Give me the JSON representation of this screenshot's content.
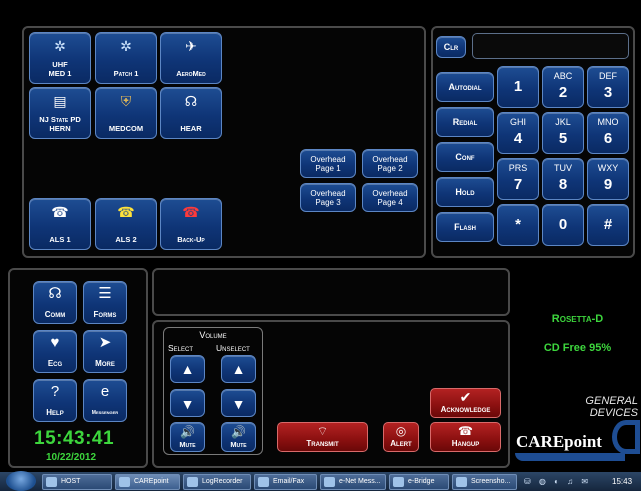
{
  "lines": [
    {
      "label": "UHF\nMED 1",
      "icon": "✲"
    },
    {
      "label": "Patch 1",
      "icon": "✲"
    },
    {
      "label": "AeroMed",
      "icon": "✈"
    },
    {
      "label": "NJ State PD\nHERN",
      "icon": "▤"
    },
    {
      "label": "MEDCOM",
      "icon": "⛨"
    },
    {
      "label": "HEAR",
      "icon": "☊"
    },
    {
      "label": "ALS 1",
      "icon": "☎"
    },
    {
      "label": "ALS 2",
      "icon": "☎"
    },
    {
      "label": "Back-Up",
      "icon": "☎"
    }
  ],
  "overhead": [
    "Overhead\nPage 1",
    "Overhead\nPage 2",
    "Overhead\nPage 3",
    "Overhead\nPage 4"
  ],
  "dialer": {
    "clear": "Clr",
    "functions": [
      "Autodial",
      "Redial",
      "Conf",
      "Hold",
      "Flash"
    ],
    "keys": [
      {
        "num": "1",
        "letters": ""
      },
      {
        "num": "2",
        "letters": "ABC"
      },
      {
        "num": "3",
        "letters": "DEF"
      },
      {
        "num": "4",
        "letters": "GHI"
      },
      {
        "num": "5",
        "letters": "JKL"
      },
      {
        "num": "6",
        "letters": "MNO"
      },
      {
        "num": "7",
        "letters": "PRS"
      },
      {
        "num": "8",
        "letters": "TUV"
      },
      {
        "num": "9",
        "letters": "WXY"
      },
      {
        "num": "*",
        "letters": ""
      },
      {
        "num": "0",
        "letters": ""
      },
      {
        "num": "#",
        "letters": ""
      }
    ]
  },
  "nav": [
    "Comm",
    "Forms",
    "Ecg",
    "More",
    "Help",
    "Messenger"
  ],
  "clock": {
    "time": "15:43:41",
    "date": "10/22/2012"
  },
  "volume": {
    "title": "Volume",
    "select": "Select",
    "unselect": "Unselect",
    "mute": "Mute"
  },
  "actions": {
    "transmit": "Transmit",
    "alert": "Alert",
    "acknowledge": "Acknowledge",
    "hangup": "Hangup"
  },
  "status": {
    "name": "Rosetta-D",
    "cd": "CD Free 95%"
  },
  "brand": {
    "company": "GENERAL\nDEVICES",
    "product": "CAREpoint"
  },
  "taskbar": {
    "items": [
      "HOST",
      "CAREpoint",
      "LogRecorder",
      "Email/Fax",
      "e-Net Mess...",
      "e-Bridge",
      "Screensho..."
    ],
    "time": "15:43"
  },
  "colors": {
    "accent_blue": "#0f3577",
    "status_green": "#3dd63d",
    "transmit_red": "#a51a1a"
  }
}
